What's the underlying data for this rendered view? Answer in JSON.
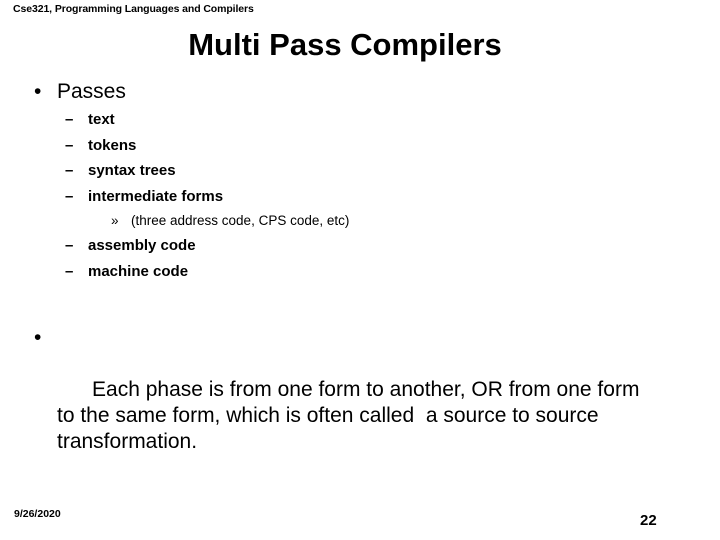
{
  "slide": {
    "course_header": "Cse321, Programming Languages and Compilers",
    "title": "Multi Pass Compilers",
    "background_color": "#ffffff",
    "text_color": "#000000"
  },
  "bullets": {
    "level1_marker": "•",
    "level2_marker": "–",
    "level3_marker": "»",
    "passes": {
      "label": "Passes",
      "items_before": [
        {
          "label": "text"
        },
        {
          "label": "tokens"
        },
        {
          "label": "syntax trees"
        },
        {
          "label": "intermediate forms"
        }
      ],
      "sub_note": "(three address code, CPS code, etc)",
      "items_after": [
        {
          "label": "assembly code"
        },
        {
          "label": "machine code"
        }
      ]
    }
  },
  "paragraph": {
    "text": "Each phase is from one form to another, OR from one form to the same form, which is often called  a source to source transformation."
  },
  "footer": {
    "date": "9/26/2020",
    "page_number": "22"
  }
}
